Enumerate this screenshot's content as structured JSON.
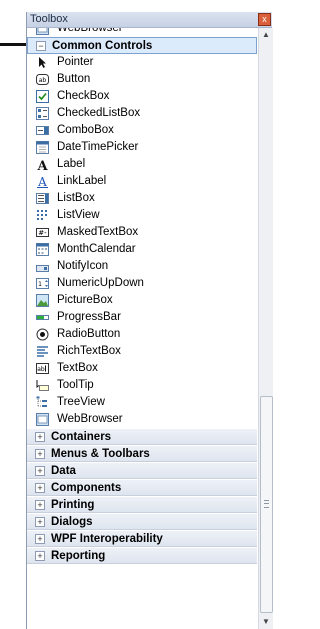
{
  "panel": {
    "title": "Toolbox",
    "close_glyph": "x"
  },
  "top_item": {
    "label": "WebBrowser",
    "icon": "webbrowser-icon"
  },
  "common_controls": {
    "label": "Common Controls",
    "expander": "−",
    "items": [
      {
        "label": "Pointer",
        "icon": "pointer-icon"
      },
      {
        "label": "Button",
        "icon": "button-icon"
      },
      {
        "label": "CheckBox",
        "icon": "checkbox-icon"
      },
      {
        "label": "CheckedListBox",
        "icon": "checkedlistbox-icon"
      },
      {
        "label": "ComboBox",
        "icon": "combobox-icon"
      },
      {
        "label": "DateTimePicker",
        "icon": "datetimepicker-icon"
      },
      {
        "label": "Label",
        "icon": "label-icon"
      },
      {
        "label": "LinkLabel",
        "icon": "linklabel-icon"
      },
      {
        "label": "ListBox",
        "icon": "listbox-icon"
      },
      {
        "label": "ListView",
        "icon": "listview-icon"
      },
      {
        "label": "MaskedTextBox",
        "icon": "maskedtextbox-icon"
      },
      {
        "label": "MonthCalendar",
        "icon": "monthcalendar-icon"
      },
      {
        "label": "NotifyIcon",
        "icon": "notifyicon-icon"
      },
      {
        "label": "NumericUpDown",
        "icon": "numericupdown-icon"
      },
      {
        "label": "PictureBox",
        "icon": "picturebox-icon"
      },
      {
        "label": "ProgressBar",
        "icon": "progressbar-icon"
      },
      {
        "label": "RadioButton",
        "icon": "radiobutton-icon"
      },
      {
        "label": "RichTextBox",
        "icon": "richtextbox-icon"
      },
      {
        "label": "TextBox",
        "icon": "textbox-icon"
      },
      {
        "label": "ToolTip",
        "icon": "tooltip-icon"
      },
      {
        "label": "TreeView",
        "icon": "treeview-icon"
      },
      {
        "label": "WebBrowser",
        "icon": "webbrowser-icon"
      }
    ]
  },
  "categories": [
    {
      "label": "Containers",
      "expander": "+"
    },
    {
      "label": "Menus & Toolbars",
      "expander": "+"
    },
    {
      "label": "Data",
      "expander": "+"
    },
    {
      "label": "Components",
      "expander": "+"
    },
    {
      "label": "Printing",
      "expander": "+"
    },
    {
      "label": "Dialogs",
      "expander": "+"
    },
    {
      "label": "WPF Interoperability",
      "expander": "+"
    },
    {
      "label": "Reporting",
      "expander": "+"
    }
  ],
  "scrollbar": {
    "up_glyph": "▲",
    "down_glyph": "▼"
  },
  "colors": {
    "selected_bg": "#dcebfb",
    "selected_border": "#7da2ce",
    "category_bg": "#e6ebf3"
  }
}
